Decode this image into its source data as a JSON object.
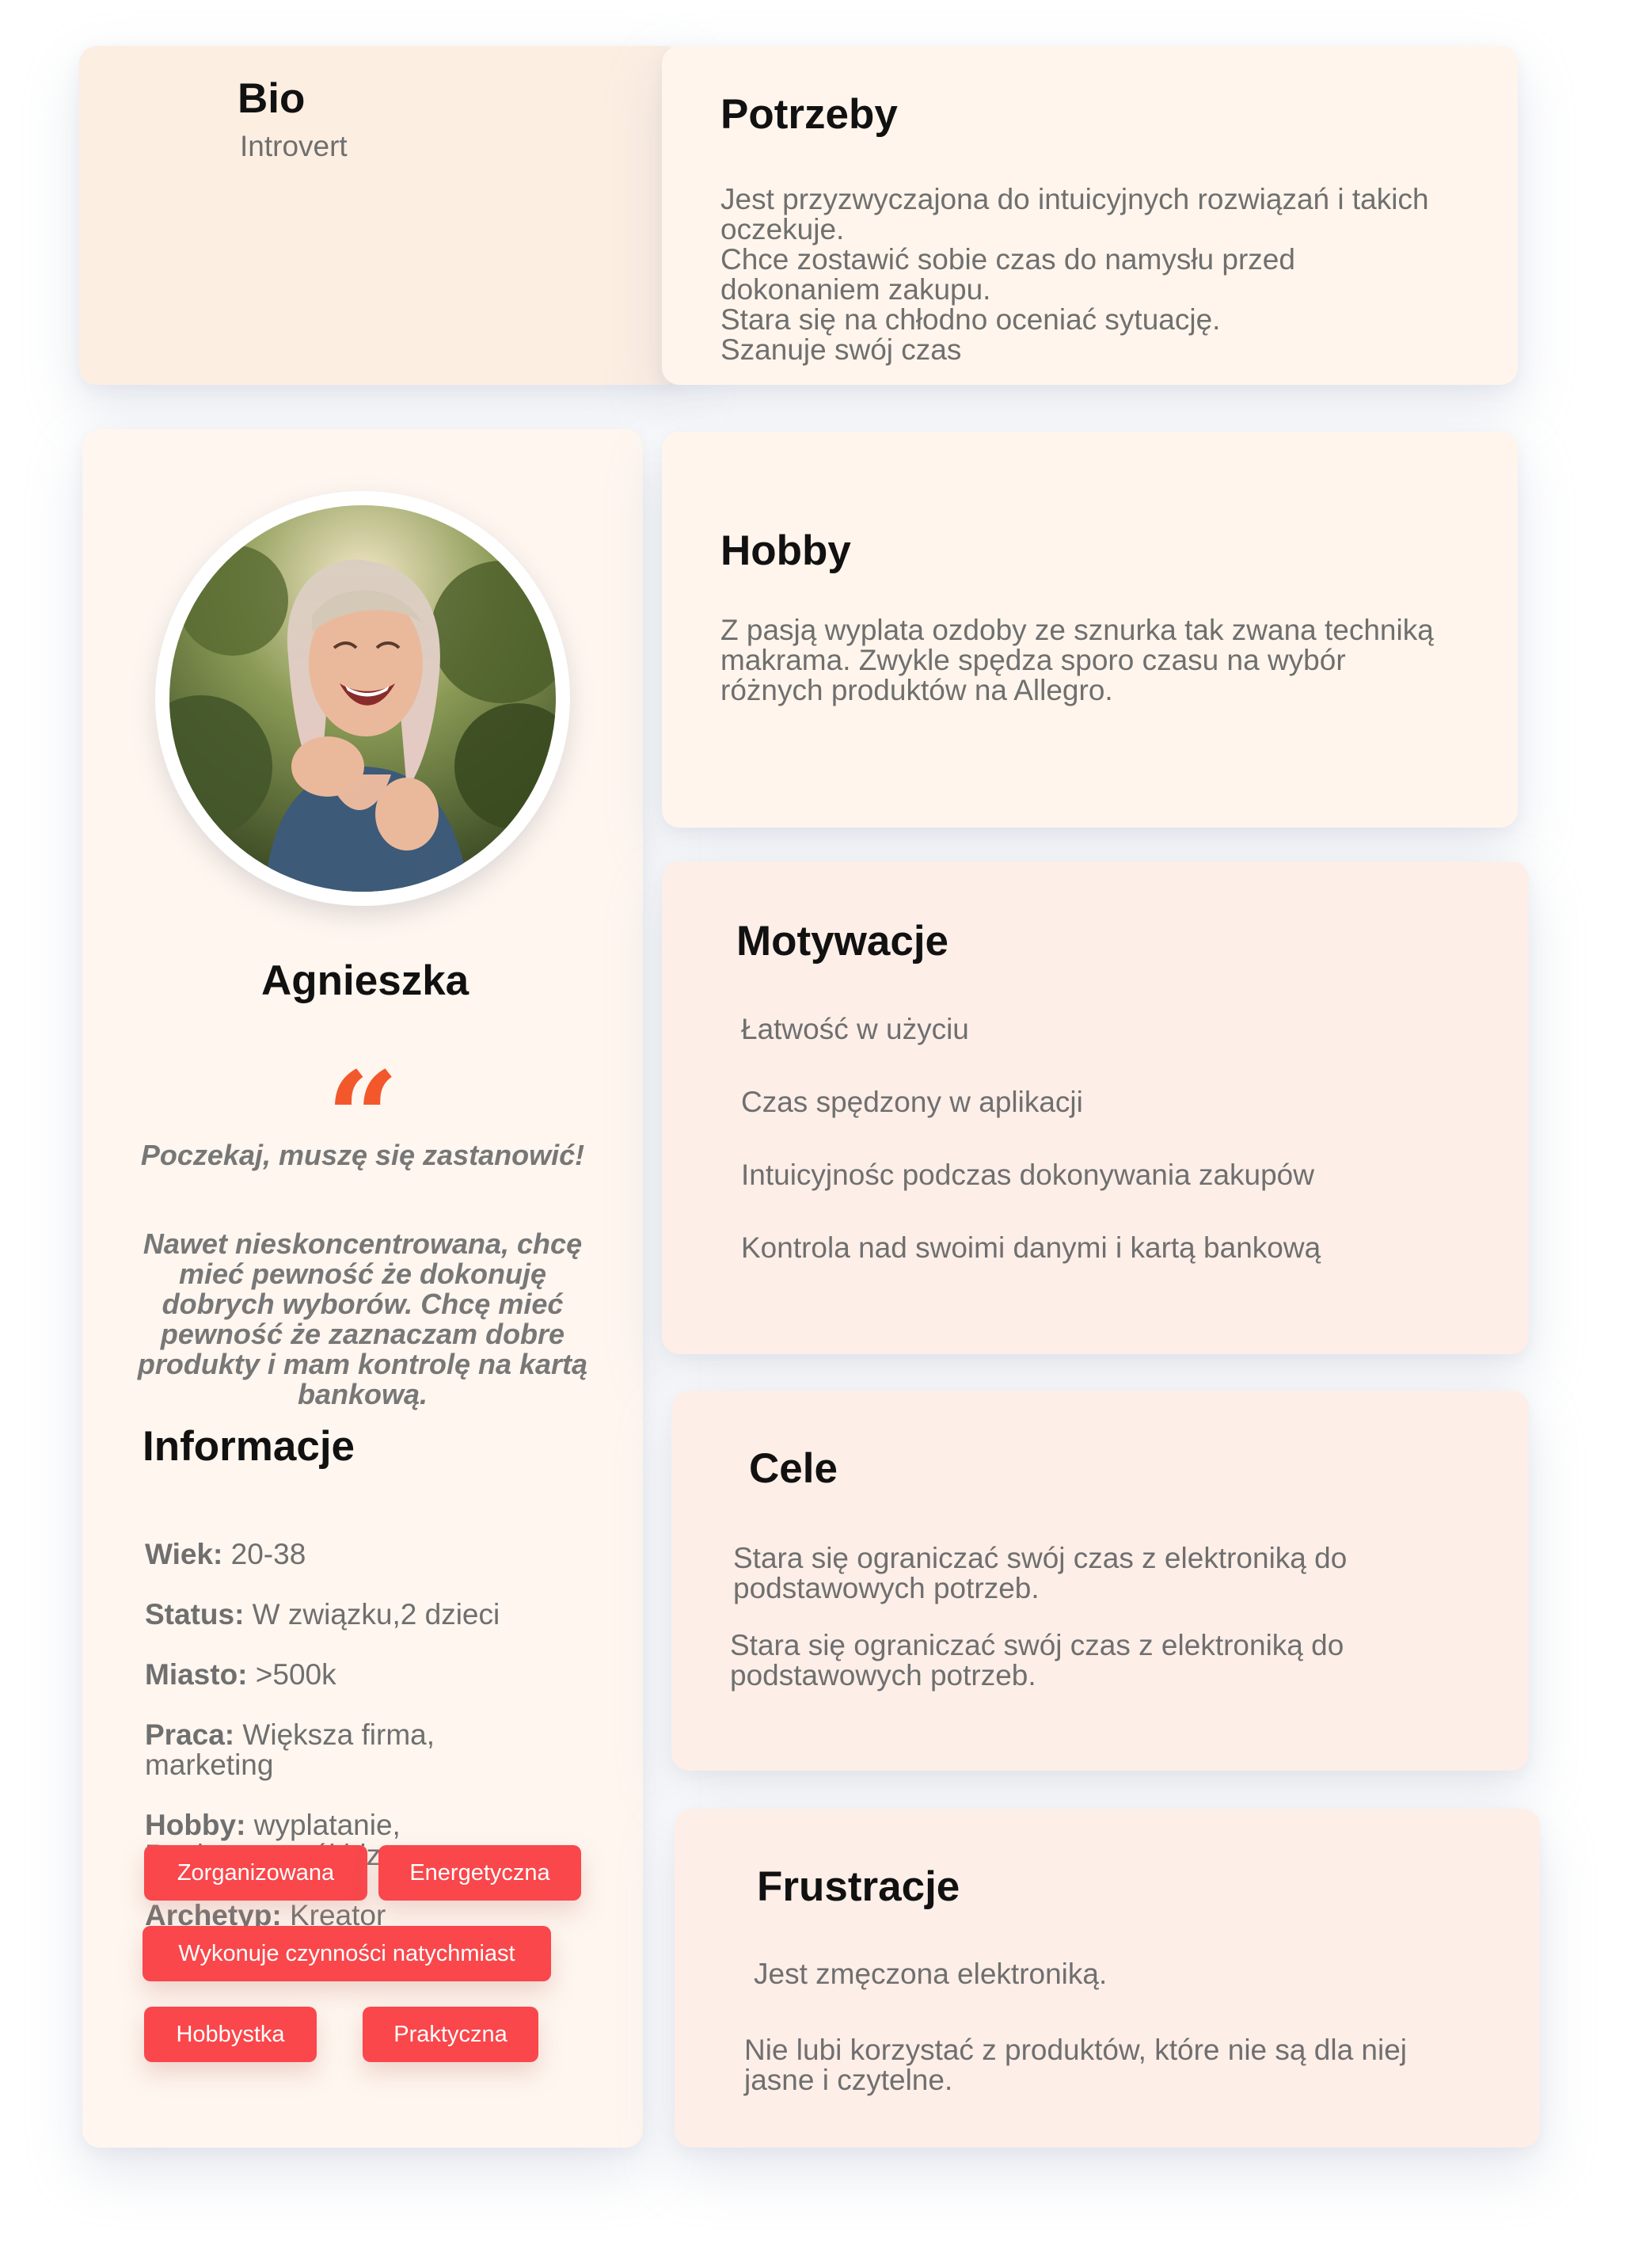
{
  "bio": {
    "title": "Bio",
    "subtitle": "Introvert"
  },
  "needs": {
    "title": "Potrzeby",
    "text": "Jest przyzwyczajona do intuicyjnych rozwiązań i takich\noczekuje.\nChce zostawić sobie czas do namysłu przed\ndokonaniem zakupu.\nStara się na chłodno oceniać sytuację.\nSzanuje swój czas"
  },
  "profile": {
    "name": "Agnieszka",
    "quote_mark": "“",
    "quote": "Poczekaj, muszę się zastanowić!",
    "statement": "Nawet nieskoncentrowana, chcę\nmieć pewność że dokonuję\ndobrych wyborów. Chcę mieć\npewność że zaznaczam dobre\nprodukty i mam kontrolę na kartą\nbankową.",
    "info_title": "Informacje",
    "info": [
      {
        "key": "Wiek:",
        "value": " 20-38"
      },
      {
        "key": "Status:",
        "value": " W związku,2 dzieci"
      },
      {
        "key": "Miasto:",
        "value": " >500k"
      },
      {
        "key": "Praca:",
        "value": " Większa firma,\nmarketing"
      },
      {
        "key": "Hobby:",
        "value": "  wyplatanie,\nRozkręca swój biznes"
      },
      {
        "key": "Archetyp:",
        "value": " Kreator"
      }
    ],
    "tags": [
      "Zorganizowana",
      "Energetyczna",
      "Wykonuje czynności natychmiast",
      "Hobbystka",
      "Praktyczna"
    ]
  },
  "hobby": {
    "title": "Hobby",
    "text": " Z pasją wyplata ozdoby ze sznurka tak zwana techniką\nmakrama. Zwykle spędza sporo czasu na wybór\nróżnych produktów na Allegro."
  },
  "motivations": {
    "title": "Motywacje",
    "items": [
      "Łatwość w użyciu",
      "Czas spędzony w aplikacji",
      "Intuicyjnośc podczas dokonywania zakupów",
      "Kontrola nad swoimi danymi i kartą bankową"
    ]
  },
  "goals": {
    "title": "Cele",
    "items": [
      "Stara się ograniczać swój czas z elektroniką do\npodstawowych potrzeb.",
      "Stara się ograniczać swój czas z elektroniką do\npodstawowych potrzeb."
    ]
  },
  "frustrations": {
    "title": "Frustracje",
    "items": [
      " Jest zmęczona elektroniką.",
      "Nie lubi korzystać z produktów, które nie są dla niej\njasne i czytelne."
    ]
  },
  "colors": {
    "accent": "#f9474b",
    "quote_mark": "#f2582c",
    "heading": "#111111",
    "body_text": "#6f6f6f"
  }
}
